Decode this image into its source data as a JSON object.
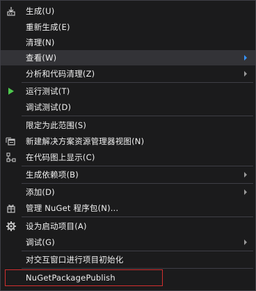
{
  "menu": {
    "build": "生成(U)",
    "rebuild": "重新生成(E)",
    "clean": "清理(N)",
    "view": "查看(W)",
    "analyze": "分析和代码清理(Z)",
    "run_tests": "运行测试(T)",
    "debug_tests": "调试测试(D)",
    "scope": "限定为此范围(S)",
    "new_solution_view": "新建解决方案资源管理器视图(N)",
    "show_on_code_map": "在代码图上显示(C)",
    "build_dependencies": "生成依赖项(B)",
    "add": "添加(D)",
    "manage_nuget": "管理 NuGet 程序包(N)...",
    "set_startup": "设为启动项目(A)",
    "debug": "调试(G)",
    "init_interactive": "对交互窗口进行项目初始化",
    "nuget_publish": "NuGetPackagePublish"
  },
  "colors": {
    "background": "#1b1b1c",
    "hover": "#333337",
    "separator": "#3f3f46",
    "submenu_arrow": "#999999",
    "submenu_arrow_active": "#3794ff",
    "run_icon": "#4ec94e",
    "highlight_border": "#d32f2f"
  }
}
